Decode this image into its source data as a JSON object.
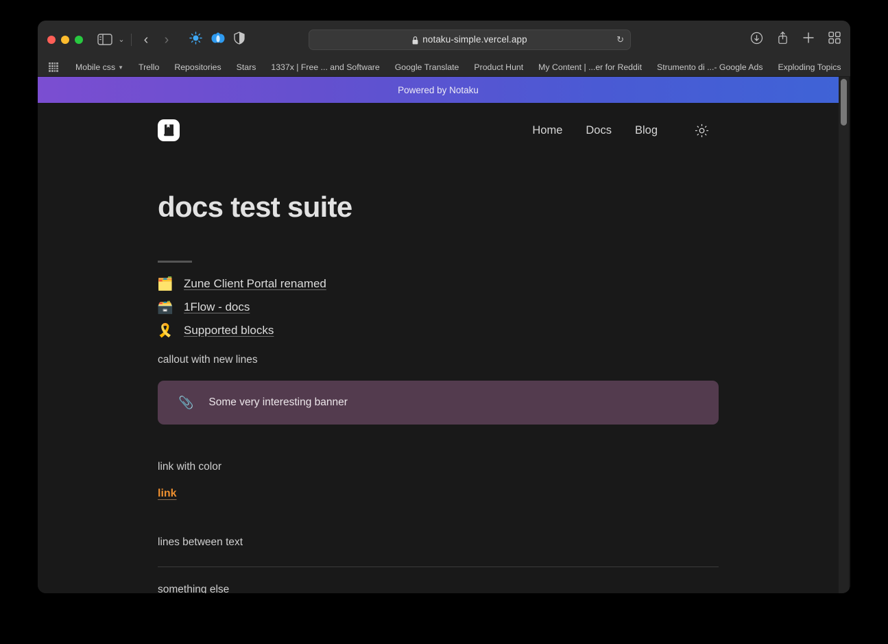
{
  "browser": {
    "window_controls": [
      "close",
      "minimize",
      "maximize"
    ],
    "toolbar": {
      "sidebar_icon": "sidebar-icon",
      "tab_overview_caret": "⌄",
      "back_label": "‹",
      "forward_label": "›",
      "extension_1": "brightness-extension-icon",
      "extension_2": "flower-extension-icon",
      "extension_3": "shield-privacy-icon",
      "url": "notaku-simple.vercel.app",
      "lock_icon": "lock-icon",
      "reload_label": "↻",
      "downloads_icon": "download-icon",
      "share_icon": "share-icon",
      "new_tab_label": "+",
      "tab_grid_icon": "tab-overview-icon"
    },
    "bookmarks": [
      {
        "label": "Mobile css",
        "has_caret": true
      },
      {
        "label": "Trello",
        "has_caret": false
      },
      {
        "label": "Repositories",
        "has_caret": false
      },
      {
        "label": "Stars",
        "has_caret": false
      },
      {
        "label": "1337x | Free ... and Software",
        "has_caret": false
      },
      {
        "label": "Google Translate",
        "has_caret": false
      },
      {
        "label": "Product Hunt",
        "has_caret": false
      },
      {
        "label": "My Content | ...er for Reddit",
        "has_caret": false
      },
      {
        "label": "Strumento di ...- Google Ads",
        "has_caret": false
      },
      {
        "label": "Exploding Topics",
        "has_caret": false
      }
    ],
    "bookmarks_overflow_label": "»"
  },
  "page": {
    "promo_banner": {
      "text": "Powered by Notaku",
      "gradient_from": "#7b4ed1",
      "gradient_to": "#3f63d6"
    },
    "header": {
      "logo_name": "notebook-logo",
      "nav": [
        {
          "label": "Home"
        },
        {
          "label": "Docs"
        },
        {
          "label": "Blog"
        }
      ],
      "theme_toggle_icon": "sun-icon"
    },
    "title": "docs test suite",
    "doc_list": [
      {
        "emoji": "🗂️",
        "emoji_name": "folder-emoji",
        "label": "Zune Client Portal renamed"
      },
      {
        "emoji": "🗃️",
        "emoji_name": "card-index-dividers-emoji",
        "label": "1Flow - docs"
      },
      {
        "emoji": "🎗️",
        "emoji_name": "reminder-ribbon-emoji",
        "label": "Supported blocks"
      }
    ],
    "callout_heading": "callout with new lines",
    "callout": {
      "emoji": "📎",
      "emoji_name": "paperclip-emoji",
      "text": "Some very interesting banner",
      "background": "#533b4e"
    },
    "link_section_heading": "link with color",
    "color_link": {
      "label": "link",
      "color": "#ef9030"
    },
    "lines_heading": "lines between text",
    "after_rule_text": "something else"
  }
}
